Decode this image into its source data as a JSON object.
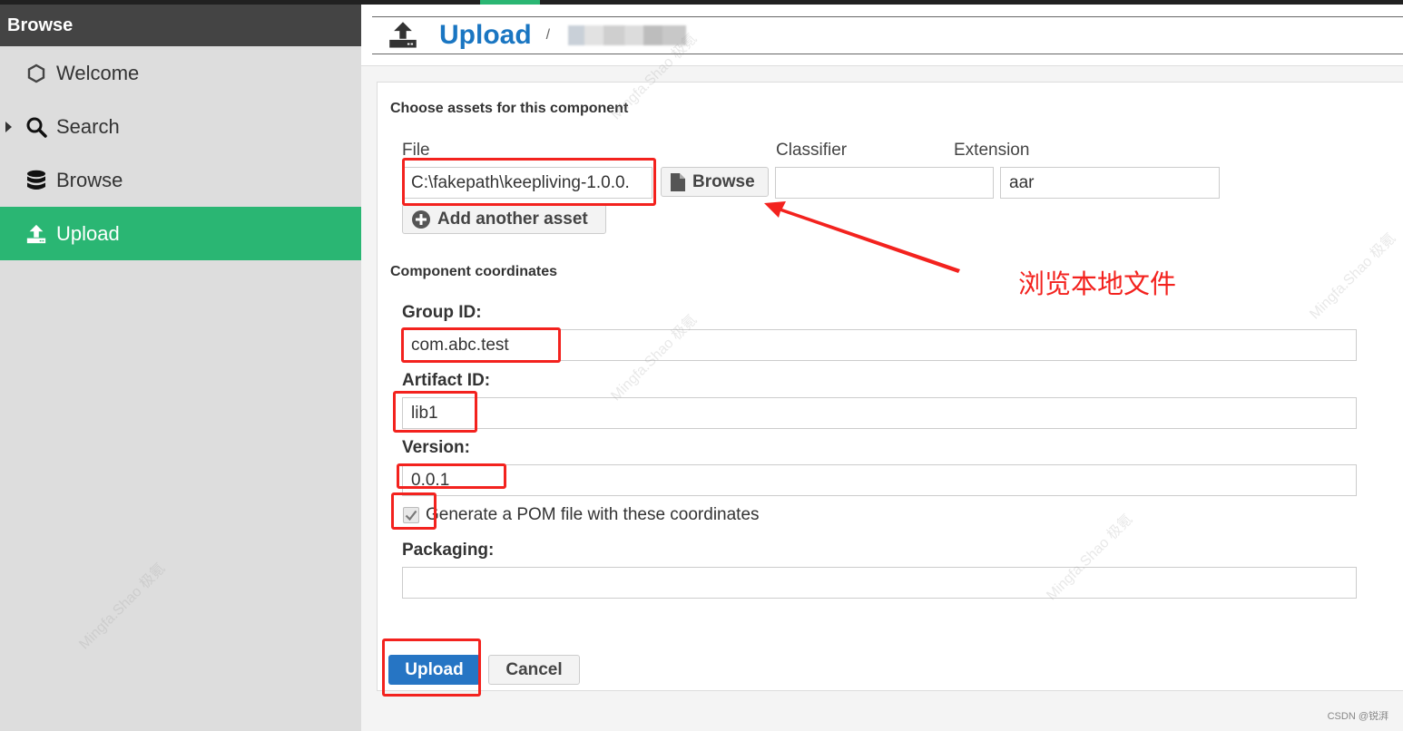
{
  "sidebar": {
    "header": "Browse",
    "items": [
      {
        "label": "Welcome",
        "icon": "hexagon-icon",
        "active": false
      },
      {
        "label": "Search",
        "icon": "search-icon",
        "active": false,
        "expandable": true
      },
      {
        "label": "Browse",
        "icon": "database-icon",
        "active": false
      },
      {
        "label": "Upload",
        "icon": "upload-icon",
        "active": true
      }
    ]
  },
  "header": {
    "title": "Upload",
    "separator": "/",
    "icon": "upload-icon"
  },
  "assets": {
    "section_title": "Choose assets for this component",
    "file_label": "File",
    "file_value": "C:\\fakepath\\keepliving-1.0.0.",
    "browse_label": "Browse",
    "classifier_label": "Classifier",
    "classifier_value": "",
    "extension_label": "Extension",
    "extension_value": "aar",
    "add_asset_label": "Add another asset"
  },
  "coordinates": {
    "section_title": "Component coordinates",
    "group_id_label": "Group ID:",
    "group_id_value": "com.abc.test",
    "artifact_id_label": "Artifact ID:",
    "artifact_id_value": "lib1",
    "version_label": "Version:",
    "version_value": "0.0.1",
    "generate_pom_label": "Generate a POM file with these coordinates",
    "generate_pom_checked": true,
    "packaging_label": "Packaging:",
    "packaging_value": ""
  },
  "actions": {
    "upload_label": "Upload",
    "cancel_label": "Cancel"
  },
  "annotations": {
    "browse_note": "浏览本地文件",
    "color": "#f3221e"
  },
  "watermark": "Mingfa.Shao 极氪",
  "footer_credit": "CSDN @锐湃",
  "colors": {
    "accent_green": "#2ab673",
    "primary_blue": "#2675c4",
    "title_blue": "#1a76c2",
    "sidebar_header": "#444444",
    "sidebar_bg": "#dddddd"
  }
}
